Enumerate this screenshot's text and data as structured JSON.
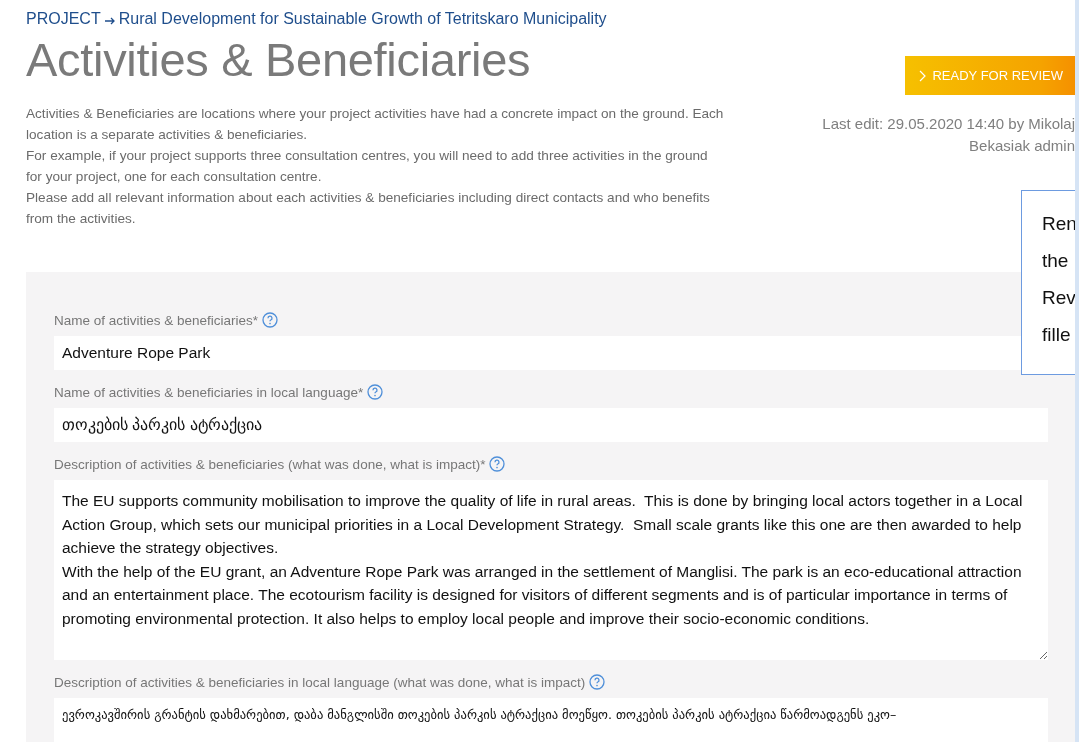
{
  "breadcrumb": {
    "root": "PROJECT",
    "project": "Rural Development for Sustainable Growth of Tetritskaro Municipality"
  },
  "title": "Activities & Beneficiaries",
  "intro": [
    "Activities & Beneficiaries are locations where your project activities have had a concrete impact on the ground. Each location is a separate activities & beneficiaries.",
    "For example, if your project supports three consultation centres, you will need to add three activities in the ground for your project, one for each consultation centre.",
    "Please add all relevant information about each activities & beneficiaries including direct contacts and who benefits from the activities."
  ],
  "review_button": "READY FOR REVIEW",
  "last_edit": [
    "Last edit: 29.05.2020 14:40 by Mikolaj",
    "Bekasiak admin"
  ],
  "tooltip": [
    "Ren",
    "the",
    "Rev",
    "fille"
  ],
  "fields": [
    {
      "kind": "input",
      "label": "Name of activities & beneficiaries*",
      "value": "Adventure Rope Park"
    },
    {
      "kind": "input",
      "label": "Name of activities & beneficiaries in local language*",
      "value": "თოკების პარკის ატრაქცია"
    },
    {
      "kind": "textarea",
      "label": "Description of activities & beneficiaries (what was done, what is impact)*",
      "value": "The EU supports community mobilisation to improve the quality of life in rural areas.  This is done by bringing local actors together in a Local Action Group, which sets our municipal priorities in a Local Development Strategy.  Small scale grants like this one are then awarded to help achieve the strategy objectives.\nWith the help of the EU grant, an Adventure Rope Park was arranged in the settlement of Manglisi. The park is an eco-educational attraction and an entertainment place. The ecotourism facility is designed for visitors of different segments and is of particular importance in terms of promoting environmental protection. It also helps to employ local people and improve their socio-economic conditions."
    },
    {
      "kind": "partial",
      "label": "Description of activities & beneficiaries in local language (what was done, what is impact)",
      "value": "ევროკავშირის გრანტის დახმარებით, დაბა მანგლისში თოკების პარკის ატრაქცია მოეწყო. თოკების პარკის ატრაქცია წარმოადგენს ეკო–"
    }
  ]
}
